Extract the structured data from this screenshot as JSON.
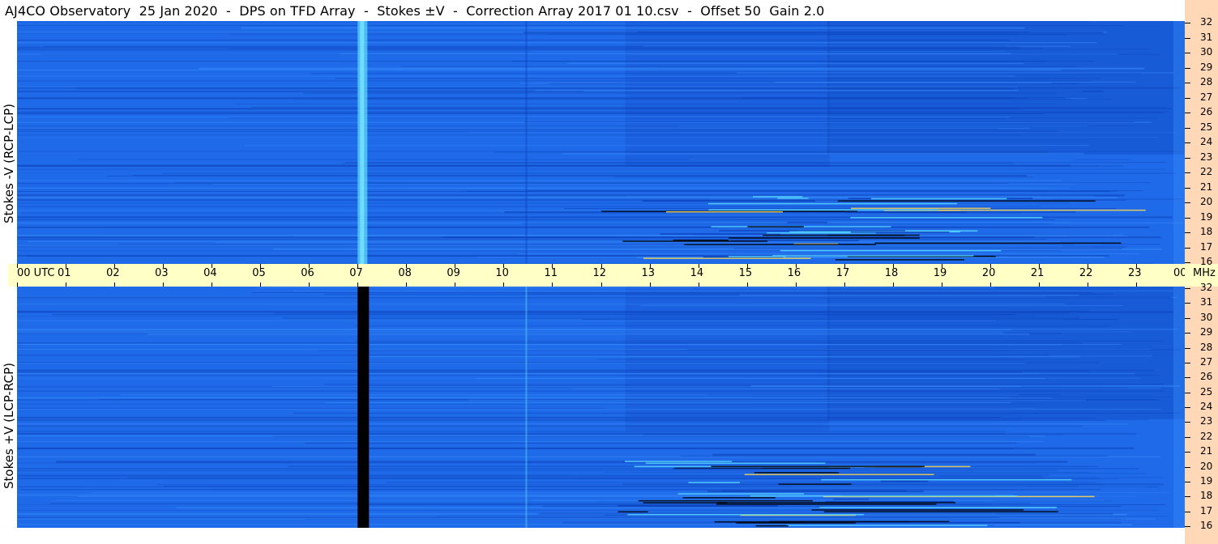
{
  "title": "AJ4CO Observatory  25 Jan 2020  -  DPS on TFD Array  -  Stokes ±V  -  Correction Array 2017 01 10.csv  -  Offset 50  Gain 2.0",
  "panels": {
    "top_label": "Stokes -V (RCP-LCP)",
    "bottom_label": "Stokes +V (LCP-RCP)"
  },
  "time_axis": {
    "labels": [
      "00 UTC",
      "01",
      "02",
      "03",
      "04",
      "05",
      "06",
      "07",
      "08",
      "09",
      "10",
      "11",
      "12",
      "13",
      "14",
      "15",
      "16",
      "17",
      "18",
      "19",
      "20",
      "21",
      "22",
      "23",
      "00"
    ],
    "unit_label": "MHz"
  },
  "freq_axis": {
    "labels": [
      "32",
      "31",
      "30",
      "29",
      "28",
      "27",
      "26",
      "25",
      "24",
      "23",
      "22",
      "21",
      "20",
      "19",
      "18",
      "17",
      "16"
    ]
  },
  "chart_data": {
    "type": "heatmap",
    "title": "AJ4CO Observatory  25 Jan 2020  -  DPS on TFD Array  -  Stokes ±V  -  Correction Array 2017 01 10.csv  -  Offset 50  Gain 2.0",
    "x_range_utc_hours": [
      0,
      24
    ],
    "y_range_mhz": [
      16,
      32
    ],
    "colors": {
      "background": "#1f6ae8",
      "dark": "#0c3fb8",
      "light": "#3a90ff",
      "cyan": "#58d8ff",
      "yellow": "#ffd84a",
      "black": "#000000",
      "axis_strip": "#ffffc6",
      "freq_strip": "#ffd8b8"
    },
    "series": [
      {
        "name": "Stokes -V (RCP-LCP)",
        "features": [
          {
            "kind": "vertical",
            "utc": 7.08,
            "color": "cyan"
          },
          {
            "kind": "vertical",
            "utc": 10.45,
            "color": "dark"
          }
        ]
      },
      {
        "name": "Stokes +V (LCP-RCP)",
        "features": [
          {
            "kind": "vertical",
            "utc": 7.08,
            "color": "black"
          },
          {
            "kind": "vertical",
            "utc": 10.45,
            "color": "cyan"
          }
        ]
      }
    ]
  }
}
